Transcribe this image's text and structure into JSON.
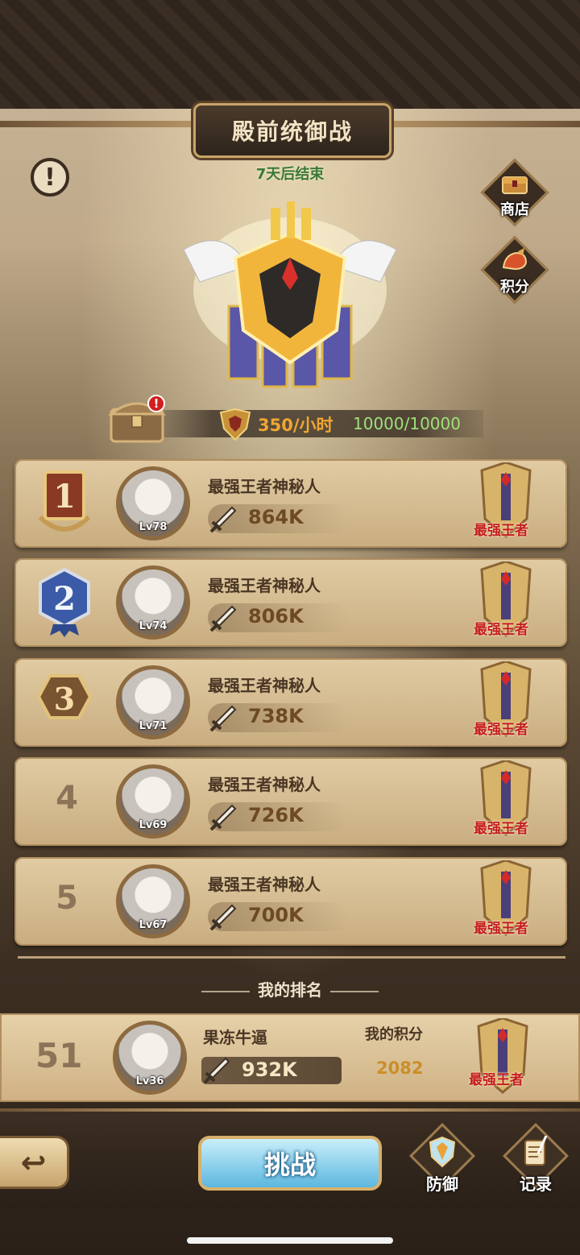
{
  "header": {
    "title": "殿前统御战",
    "subtitle": "7天后结束"
  },
  "side_buttons": {
    "shop": {
      "label": "商店",
      "icon": "chest-icon"
    },
    "points": {
      "label": "积分",
      "icon": "points-icon"
    }
  },
  "reward": {
    "rate": "350/小时",
    "capacity": "10000/10000",
    "chest_alert": "!"
  },
  "rankings": [
    {
      "rank": "1",
      "name": "最强王者神秘人",
      "level": "Lv78",
      "power": "864K",
      "tier": "最强王者"
    },
    {
      "rank": "2",
      "name": "最强王者神秘人",
      "level": "Lv74",
      "power": "806K",
      "tier": "最强王者"
    },
    {
      "rank": "3",
      "name": "最强王者神秘人",
      "level": "Lv71",
      "power": "738K",
      "tier": "最强王者"
    },
    {
      "rank": "4",
      "name": "最强王者神秘人",
      "level": "Lv69",
      "power": "726K",
      "tier": "最强王者"
    },
    {
      "rank": "5",
      "name": "最强王者神秘人",
      "level": "Lv67",
      "power": "700K",
      "tier": "最强王者"
    }
  ],
  "my_rank": {
    "heading": "我的排名",
    "rank": "51",
    "name": "果冻牛逼",
    "level": "Lv36",
    "power": "932K",
    "score_label": "我的积分",
    "score": "2082",
    "tier": "最强王者"
  },
  "bottom_nav": {
    "back_icon": "↩",
    "challenge": "挑战",
    "defense": "防御",
    "records": "记录"
  },
  "colors": {
    "tier_red": "#c41d1d",
    "gold": "#d8b06c",
    "timer_green": "#3b7a33",
    "rate_orange": "#f0a632"
  }
}
